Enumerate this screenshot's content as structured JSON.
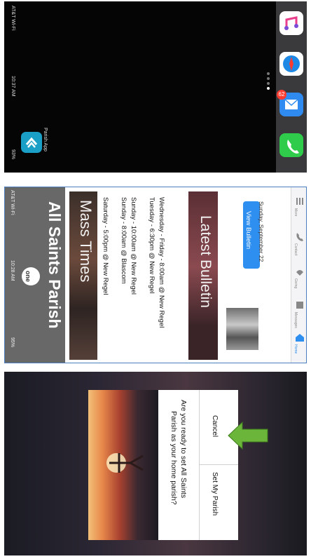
{
  "home": {
    "status": {
      "carrier": "AT&T Wi-Fi",
      "time": "10:37 AM",
      "battery": "93%"
    },
    "app_label": "Parish App",
    "mail_badge": "62",
    "icons": [
      "parish-app-icon",
      "phone-icon",
      "mail-icon",
      "safari-icon",
      "music-icon"
    ]
  },
  "app": {
    "status": {
      "carrier": "AT&T Wi-Fi",
      "time": "10:28 AM",
      "battery": "95%"
    },
    "logo_text": "one",
    "title": "All Saints Parish",
    "mass_header": "Mass Times",
    "mass_times": [
      "Saturday - 5:00pm @ New Regel",
      "Sunday - 8:00am @ Blascom",
      "Sunday - 10:00am @ New Regel",
      "Tuesday - 6:30pm @ New Regel",
      "Wednesday - Friday - 8:00am @ New Regel"
    ],
    "bulletin_header": "Latest Bulletin",
    "bulletin_button": "View Bulletin",
    "bulletin_date": "Sunday, September 22",
    "tabs": [
      "Home",
      "Messages",
      "Giving",
      "Contact",
      "More"
    ]
  },
  "dialog": {
    "question_line1": "Are you ready to set All Saints",
    "question_line2": "Parish as your home parish?",
    "cancel_label": "Cancel",
    "confirm_label": "Set My Parish",
    "arrow_color": "#6bb53a"
  }
}
